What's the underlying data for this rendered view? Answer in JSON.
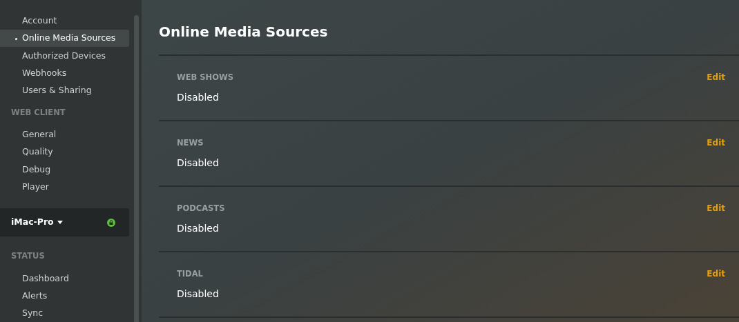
{
  "sidebar": {
    "groups": [
      {
        "items": [
          {
            "label": "Account",
            "selected": false
          },
          {
            "label": "Online Media Sources",
            "selected": true
          },
          {
            "label": "Authorized Devices",
            "selected": false
          },
          {
            "label": "Webhooks",
            "selected": false
          },
          {
            "label": "Users & Sharing",
            "selected": false
          }
        ]
      },
      {
        "heading": "WEB CLIENT",
        "items": [
          {
            "label": "General",
            "selected": false
          },
          {
            "label": "Quality",
            "selected": false
          },
          {
            "label": "Debug",
            "selected": false
          },
          {
            "label": "Player",
            "selected": false
          }
        ]
      }
    ],
    "server": {
      "name": "iMac-Pro",
      "secure": true
    },
    "status_group": {
      "heading": "STATUS",
      "items": [
        {
          "label": "Dashboard",
          "selected": false
        },
        {
          "label": "Alerts",
          "selected": false
        },
        {
          "label": "Sync",
          "selected": false
        }
      ]
    }
  },
  "main": {
    "title": "Online Media Sources",
    "sections": [
      {
        "label": "WEB SHOWS",
        "value": "Disabled",
        "action": "Edit"
      },
      {
        "label": "NEWS",
        "value": "Disabled",
        "action": "Edit"
      },
      {
        "label": "PODCASTS",
        "value": "Disabled",
        "action": "Edit"
      },
      {
        "label": "TIDAL",
        "value": "Disabled",
        "action": "Edit"
      }
    ]
  }
}
